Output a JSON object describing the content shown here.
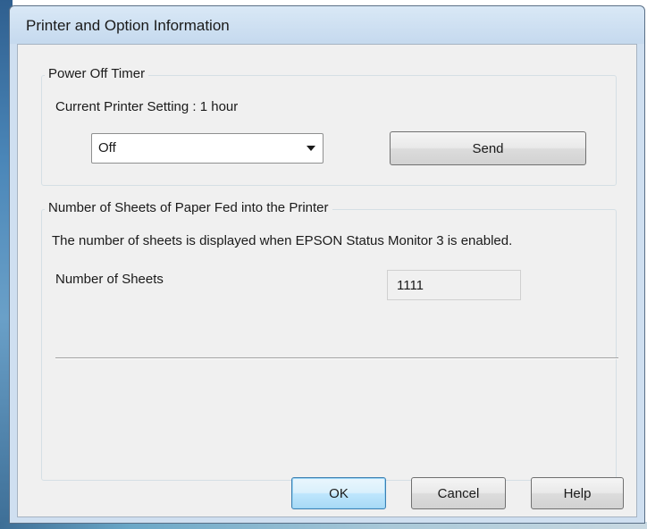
{
  "window": {
    "title": "Printer and Option Information"
  },
  "power_off_timer": {
    "legend": "Power Off Timer",
    "current_setting_label": "Current Printer Setting : 1 hour",
    "selected_option": "Off",
    "send_label": "Send"
  },
  "sheets": {
    "legend": "Number of Sheets of Paper Fed into the Printer",
    "info_text": "The number of sheets is displayed when EPSON Status Monitor 3 is enabled.",
    "count_label": "Number of Sheets",
    "count_value": "1111"
  },
  "buttons": {
    "ok_label": "OK",
    "cancel_label": "Cancel",
    "help_label": "Help"
  }
}
